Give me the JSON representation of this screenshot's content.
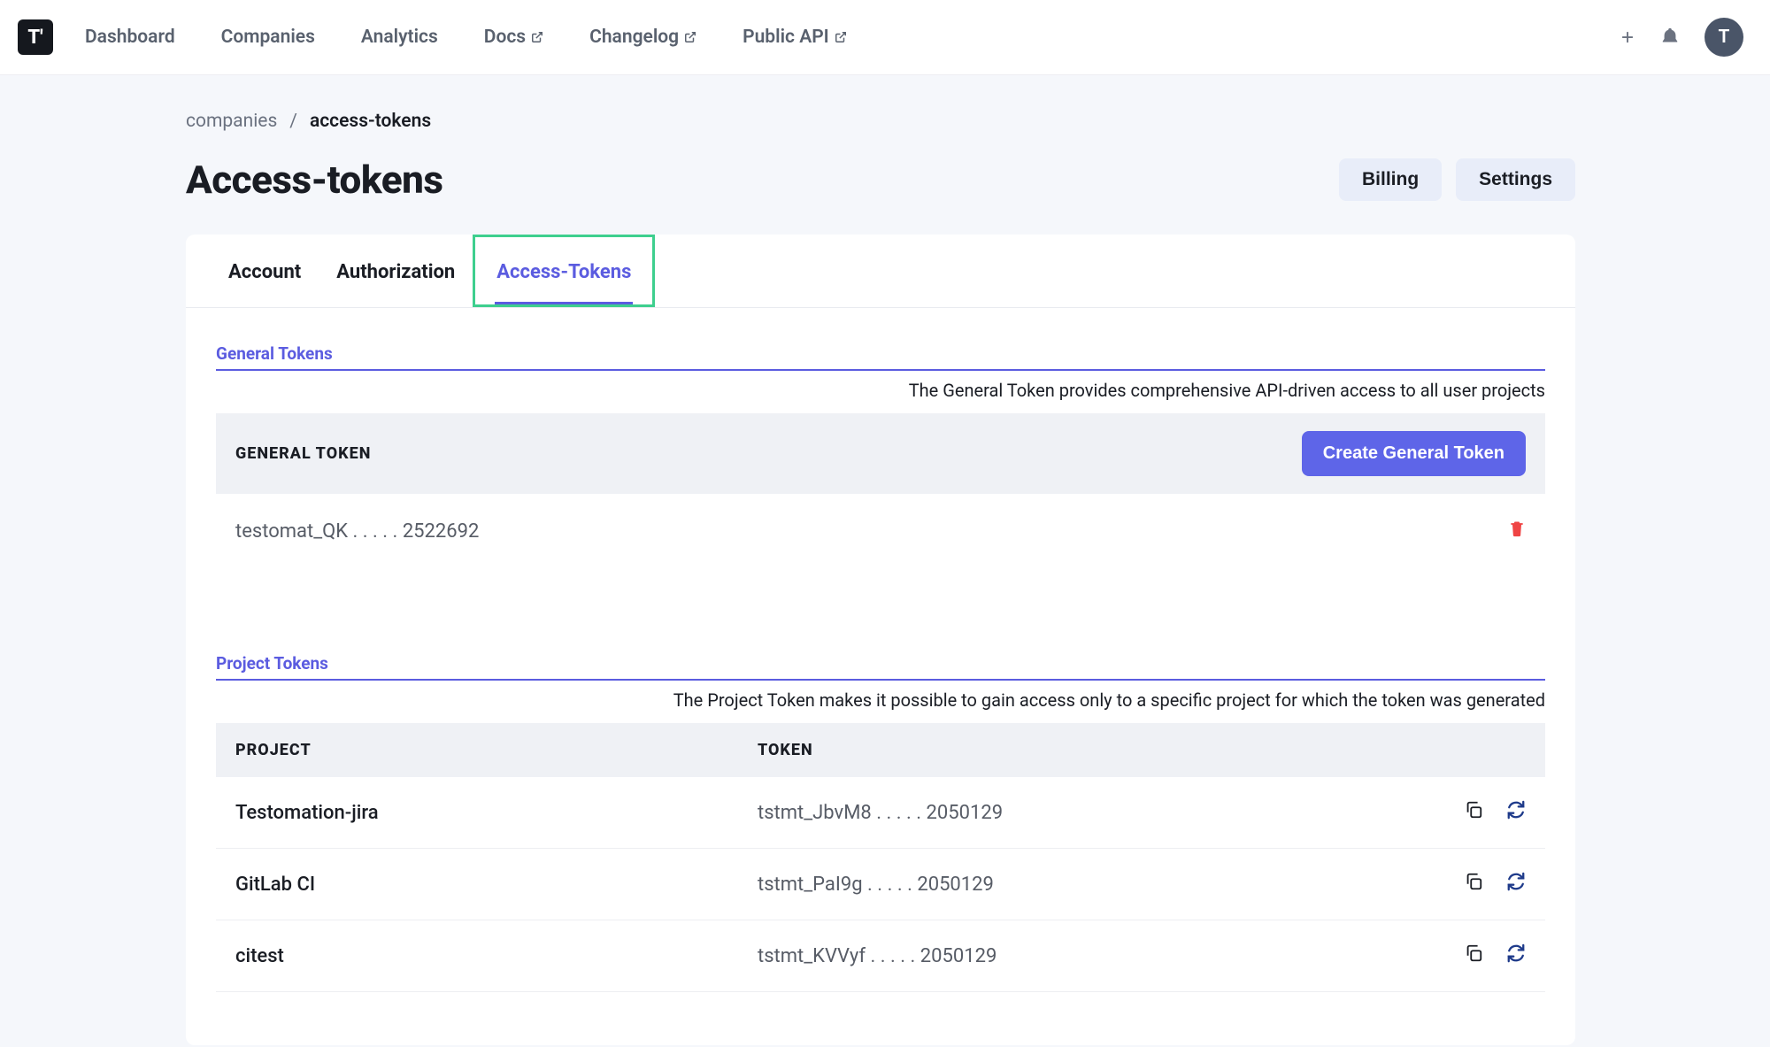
{
  "nav": {
    "dashboard": "Dashboard",
    "companies": "Companies",
    "analytics": "Analytics",
    "docs": "Docs",
    "changelog": "Changelog",
    "publicapi": "Public API"
  },
  "avatar": "T",
  "breadcrumb": {
    "parent": "companies",
    "sep": "/",
    "current": "access-tokens"
  },
  "page": {
    "title": "Access-tokens",
    "billing": "Billing",
    "settings": "Settings"
  },
  "tabs": {
    "account": "Account",
    "authorization": "Authorization",
    "accesstokens": "Access-Tokens"
  },
  "general": {
    "heading": "General Tokens",
    "desc": "The General Token provides comprehensive API-driven access to all user projects",
    "label": "GENERAL TOKEN",
    "create": "Create General Token",
    "token": "testomat_QK . . . . . 2522692"
  },
  "project": {
    "heading": "Project Tokens",
    "desc": "The Project Token makes it possible to gain access only to a specific project for which the token was generated",
    "col_project": "PROJECT",
    "col_token": "TOKEN",
    "rows": [
      {
        "name": "Testomation-jira",
        "token": "tstmt_JbvM8 . . . . . 2050129"
      },
      {
        "name": "GitLab CI",
        "token": "tstmt_PaI9g . . . . . 2050129"
      },
      {
        "name": "citest",
        "token": "tstmt_KVVyf . . . . . 2050129"
      }
    ]
  }
}
